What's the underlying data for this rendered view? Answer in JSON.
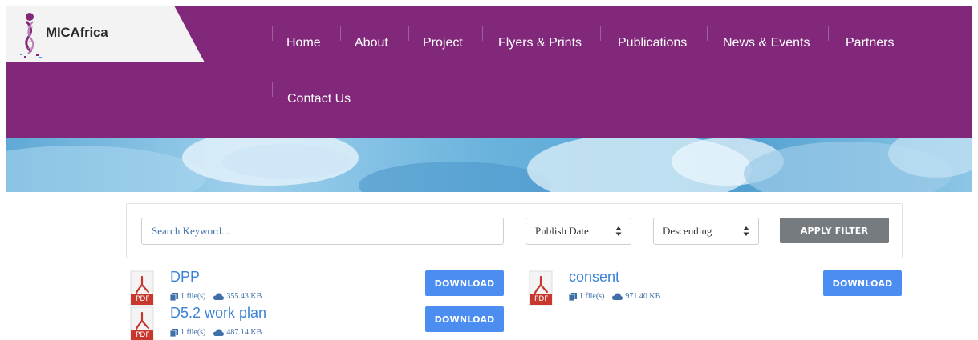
{
  "brand": {
    "name": "MICAfrica"
  },
  "nav": {
    "items": [
      {
        "label": "Home"
      },
      {
        "label": "About"
      },
      {
        "label": "Project"
      },
      {
        "label": "Flyers & Prints"
      },
      {
        "label": "Publications"
      },
      {
        "label": "News & Events"
      },
      {
        "label": "Partners"
      },
      {
        "label": "Contact Us"
      }
    ]
  },
  "filter": {
    "search_placeholder": "Search Keyword...",
    "sort_by": "Publish Date",
    "order": "Descending",
    "apply_label": "APPLY FILTER"
  },
  "documents": [
    {
      "title": "DPP",
      "files": "1 file(s)",
      "size": "355.43 KB",
      "icon_label": "PDF",
      "download_label": "DOWNLOAD"
    },
    {
      "title": "consent",
      "files": "1 file(s)",
      "size": "971.40 KB",
      "icon_label": "PDF",
      "download_label": "DOWNLOAD"
    },
    {
      "title": "D5.2 work plan",
      "files": "1 file(s)",
      "size": "487.14 KB",
      "icon_label": "PDF",
      "download_label": "DOWNLOAD"
    }
  ],
  "colors": {
    "header": "#81287a",
    "download_button": "#4b8df0",
    "apply_button": "#767b80",
    "link": "#3b82d6",
    "pdf_red": "#c8372d"
  },
  "icons": {
    "file": "files-icon",
    "size": "cloud-icon",
    "document": "pdf-icon"
  }
}
